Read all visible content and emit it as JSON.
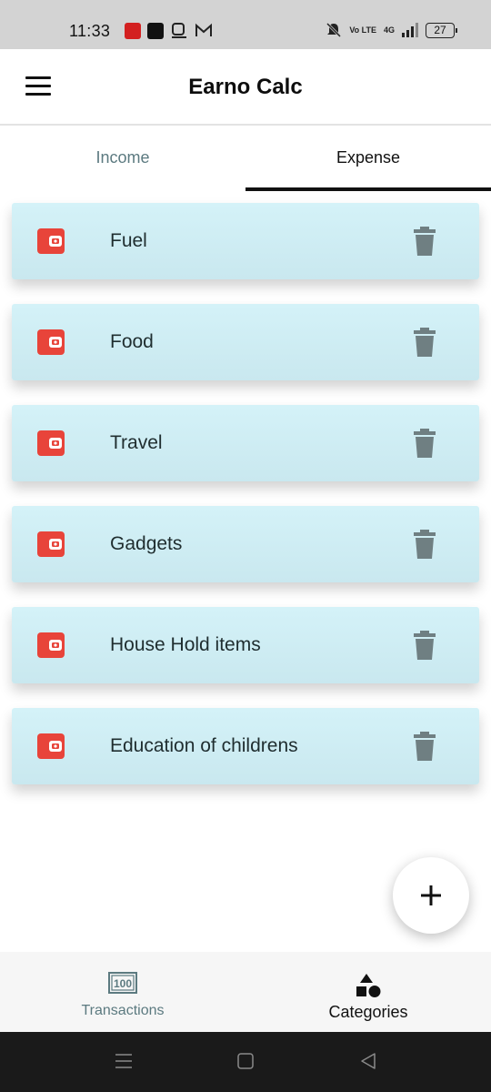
{
  "status_bar": {
    "time": "11:33",
    "network": "4G",
    "volte": "Vo LTE",
    "battery": "27"
  },
  "app_bar": {
    "title": "Earno Calc",
    "menu_icon": "hamburger-menu-icon"
  },
  "tabs": [
    {
      "label": "Income",
      "active": false
    },
    {
      "label": "Expense",
      "active": true
    }
  ],
  "categories": [
    {
      "label": "Fuel",
      "icon": "wallet-icon"
    },
    {
      "label": "Food",
      "icon": "wallet-icon"
    },
    {
      "label": "Travel",
      "icon": "wallet-icon"
    },
    {
      "label": "Gadgets",
      "icon": "wallet-icon"
    },
    {
      "label": "House Hold items",
      "icon": "wallet-icon"
    },
    {
      "label": "Education of childrens",
      "icon": "wallet-icon"
    }
  ],
  "fab": {
    "icon": "plus-icon"
  },
  "bottom_nav": [
    {
      "label": "Transactions",
      "icon": "money-icon",
      "active": false
    },
    {
      "label": "Categories",
      "icon": "shapes-icon",
      "active": true
    }
  ],
  "colors": {
    "card_background": "#d4f2f8",
    "wallet_icon": "#e8443a",
    "trash_icon": "#6f7f82",
    "inactive_text": "#5c7a80",
    "active_text": "#111111"
  }
}
